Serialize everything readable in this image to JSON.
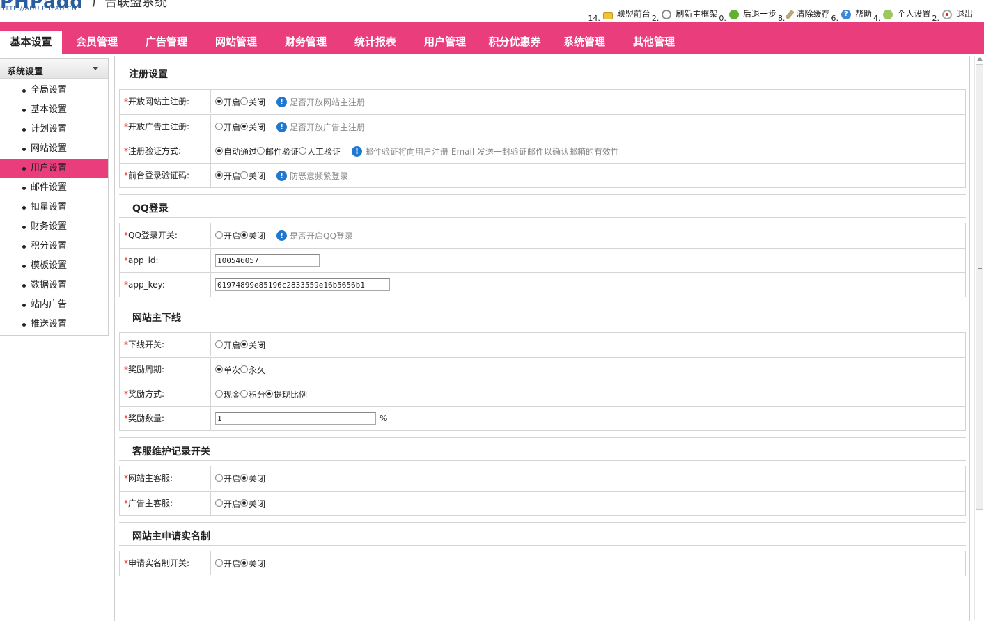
{
  "header": {
    "logo": "PHPadd",
    "logo_url": "HTTP://ADU.PHPAD.CN",
    "site_title": "广告联盟系统",
    "top_links": [
      {
        "num": "14.",
        "icon": "folder-icon",
        "label": "联盟前台"
      },
      {
        "num": "2.",
        "icon": "refresh-icon",
        "label": "刷新主框架"
      },
      {
        "num": "0.",
        "icon": "back-icon",
        "label": "后退一步"
      },
      {
        "num": "8.",
        "icon": "broom-icon",
        "label": "清除缓存"
      },
      {
        "num": "6.",
        "icon": "help-icon",
        "label": "帮助"
      },
      {
        "num": "4.",
        "icon": "user-icon",
        "label": "个人设置"
      },
      {
        "num": "2.",
        "icon": "exit-icon",
        "label": "退出"
      }
    ]
  },
  "nav": {
    "tabs": [
      {
        "label": "基本设置",
        "active": true
      },
      {
        "label": "会员管理"
      },
      {
        "label": "广告管理"
      },
      {
        "label": "网站管理"
      },
      {
        "label": "财务管理"
      },
      {
        "label": "统计报表"
      },
      {
        "label": "用户管理"
      },
      {
        "label": "积分优惠券"
      },
      {
        "label": "系统管理"
      },
      {
        "label": "其他管理"
      }
    ]
  },
  "sidebar": {
    "title": "系统设置",
    "items": [
      {
        "label": "全局设置"
      },
      {
        "label": "基本设置"
      },
      {
        "label": "计划设置"
      },
      {
        "label": "网站设置"
      },
      {
        "label": "用户设置",
        "active": true
      },
      {
        "label": "邮件设置"
      },
      {
        "label": "扣量设置"
      },
      {
        "label": "财务设置"
      },
      {
        "label": "积分设置"
      },
      {
        "label": "模板设置"
      },
      {
        "label": "数据设置"
      },
      {
        "label": "站内广告"
      },
      {
        "label": "推送设置"
      }
    ]
  },
  "colors": {
    "accent": "#ea3d7c",
    "required": "#e03030",
    "info": "#1f77d0"
  },
  "sections": [
    {
      "title": "注册设置",
      "rows": [
        {
          "label": "开放网站主注册:",
          "options": [
            "开启",
            "关闭"
          ],
          "selected": 0,
          "hint": "是否开放网站主注册"
        },
        {
          "label": "开放广告主注册:",
          "options": [
            "开启",
            "关闭"
          ],
          "selected": 1,
          "hint": "是否开放广告主注册"
        },
        {
          "label": "注册验证方式:",
          "options": [
            "自动通过",
            "邮件验证",
            "人工验证"
          ],
          "selected": 0,
          "hint": "邮件验证将向用户注册 Email 发送一封验证邮件以确认邮箱的有效性"
        },
        {
          "label": "前台登录验证码:",
          "options": [
            "开启",
            "关闭"
          ],
          "selected": 0,
          "hint": "防恶意频繁登录"
        }
      ]
    },
    {
      "title": "QQ登录",
      "rows": [
        {
          "label": "QQ登录开关:",
          "options": [
            "开启",
            "关闭"
          ],
          "selected": 1,
          "hint": "是否开启QQ登录"
        },
        {
          "label": "app_id:",
          "input": "100546057"
        },
        {
          "label": "app_key:",
          "input": "01974899e85196c2833559e16b5656b1"
        }
      ]
    },
    {
      "title": "网站主下线",
      "rows": [
        {
          "label": "下线开关:",
          "options": [
            "开启",
            "关闭"
          ],
          "selected": 1
        },
        {
          "label": "奖励周期:",
          "options": [
            "单次",
            "永久"
          ],
          "selected": 0
        },
        {
          "label": "奖励方式:",
          "options": [
            "现金",
            "积分",
            "提现比例"
          ],
          "selected": 2
        },
        {
          "label": "奖励数量:",
          "input": "1",
          "unit": "%"
        }
      ]
    },
    {
      "title": "客服维护记录开关",
      "rows": [
        {
          "label": "网站主客服:",
          "options": [
            "开启",
            "关闭"
          ],
          "selected": 1
        },
        {
          "label": "广告主客服:",
          "options": [
            "开启",
            "关闭"
          ],
          "selected": 1
        }
      ]
    },
    {
      "title": "网站主申请实名制",
      "rows": [
        {
          "label": "申请实名制开关:",
          "options": [
            "开启",
            "关闭"
          ],
          "selected": 1
        }
      ]
    }
  ]
}
